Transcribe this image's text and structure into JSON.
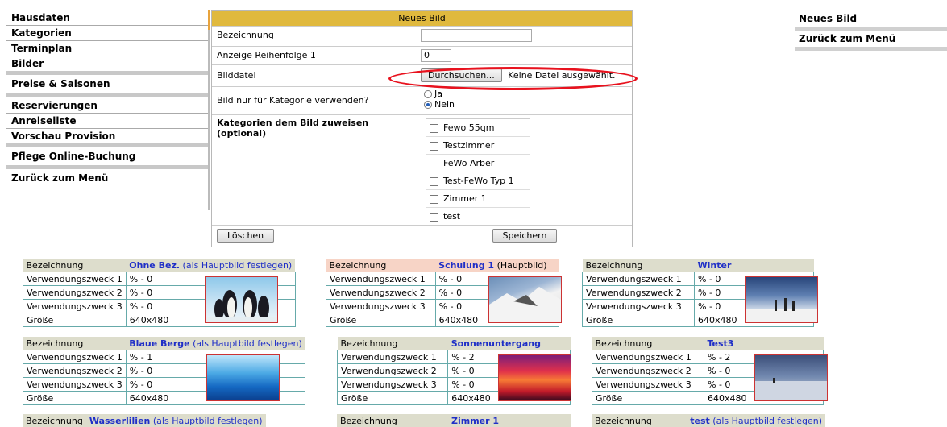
{
  "left_menu": [
    {
      "label": "Hausdaten",
      "sep": false
    },
    {
      "label": "Kategorien",
      "sep": false
    },
    {
      "label": "Terminplan",
      "sep": false
    },
    {
      "label": "Bilder",
      "sep": true
    },
    {
      "label": "Preise & Saisonen",
      "sep": true
    },
    {
      "label": "Reservierungen",
      "sep": false
    },
    {
      "label": "Anreiseliste",
      "sep": false
    },
    {
      "label": "Vorschau Provision",
      "sep": true
    },
    {
      "label": "Pflege Online-Buchung",
      "sep": true
    },
    {
      "label": "Zurück zum Menü",
      "sep": false
    }
  ],
  "right_menu": [
    "Neues Bild",
    "Zurück zum Menü"
  ],
  "form": {
    "title": "Neues Bild",
    "bezeichnung_label": "Bezeichnung",
    "bezeichnung_value": "",
    "reihenfolge_label": "Anzeige Reihenfolge 1",
    "reihenfolge_value": "0",
    "datei_label": "Bilddatei",
    "browse_button": "Durchsuchen...",
    "no_file": "Keine Datei ausgewählt.",
    "kategorie_only_label": "Bild nur für Kategorie verwenden?",
    "radio_ja": "Ja",
    "radio_nein": "Nein",
    "kategorien_label": "Kategorien dem Bild zuweisen (optional)",
    "kategorien": [
      "Fewo 55qm",
      "Testzimmer",
      "FeWo Arber",
      "Test-FeWo Typ 1",
      "Zimmer 1",
      "test"
    ],
    "delete_button": "Löschen",
    "save_button": "Speichern"
  },
  "card_labels": {
    "bezeichnung": "Bezeichnung",
    "vz1": "Verwendungszweck 1",
    "vz2": "Verwendungszweck 2",
    "vz3": "Verwendungszweck 3",
    "groesse": "Größe"
  },
  "cards": [
    {
      "name": "Ohne Bez.",
      "extra": "(als Hauptbild festlegen)",
      "vz1": "% - 0",
      "vz2": "% - 0",
      "vz3": "% - 0",
      "size": "640x480",
      "thumb": "penguins"
    },
    {
      "name": "Schulung 1",
      "extra": "(Hauptbild)",
      "vz1": "% - 0",
      "vz2": "% - 0",
      "vz3": "% - 0",
      "size": "640x480",
      "thumb": "snow-mountain"
    },
    {
      "name": "Winter",
      "extra": "",
      "vz1": "% - 0",
      "vz2": "% - 0",
      "vz3": "% - 0",
      "size": "640x480",
      "thumb": "winter-hikers"
    },
    {
      "name": "Blaue Berge",
      "extra": "(als Hauptbild festlegen)",
      "vz1": "% - 1",
      "vz2": "% - 0",
      "vz3": "% - 0",
      "size": "640x480",
      "thumb": "blue-hills"
    },
    {
      "name": "Sonnenuntergang",
      "extra": "",
      "vz1": "% - 2",
      "vz2": "% - 0",
      "vz3": "% - 0",
      "size": "640x480",
      "thumb": "sunset"
    },
    {
      "name": "Test3",
      "extra": "",
      "vz1": "% - 2",
      "vz2": "% - 0",
      "vz3": "% - 0",
      "size": "640x480",
      "thumb": "snow-field"
    },
    {
      "name": "Wasserlilien",
      "extra": "(als Hauptbild festlegen)"
    },
    {
      "name": "Zimmer 1",
      "extra": ""
    },
    {
      "name": "test",
      "extra": "(als Hauptbild festlegen)"
    }
  ]
}
